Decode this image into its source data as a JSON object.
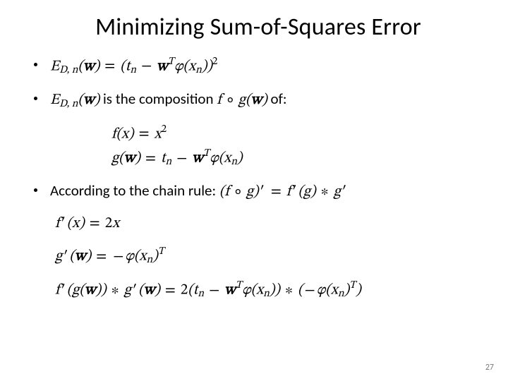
{
  "title": "Minimizing Sum-of-Squares Error",
  "bullet1_html": "E<sub>D, n</sub>(<b>w</b>) <span class='op'>=</span> (t<sub>n</sub> <span class='op'>−</span> <b>w</b><sup>T</sup>φ(x<sub>n</sub>))<sup><span class='upright'>2</span></sup>",
  "bullet2_prefix_html": "E<sub>D, n</sub>(<b>w</b>)",
  "bullet2_mid_text": " is the composition ",
  "bullet2_comp_html": "f <span class='op'>∘</span> g(<b>w</b>)",
  "bullet2_suffix_text": " of:",
  "block_f_html": "f(x) <span class='op'>=</span> x<sup><span class='upright'>2</span></sup>",
  "block_g_html": "g(<b>w</b>) <span class='op'>=</span> t<sub>n</sub> <span class='op'>−</span> <b>w</b><sup>T</sup>φ(x<sub>n</sub>)",
  "bullet3_text": "According to the chain rule: ",
  "bullet3_rule_html": "(f <span class='op'>∘</span> g)<span class='op'>′</span> <span class='op'>=</span> f<span class='op'>′</span>(g) <span class='op'>∗</span> g<span class='op'>′</span>",
  "deriv_fprime_html": "f<span class='op'>′</span>(x) <span class='op'>=</span> <span class='upright'>2</span>x",
  "deriv_gprime_html": "g<span class='op'>′</span>(<b>w</b>) <span class='op'>=</span> <span class='op'>−</span>φ(x<sub>n</sub>)<sup>T</sup>",
  "deriv_full_html": "f<span class='op'>′</span>(g(<b>w</b>)) <span class='op'>∗</span> g<span class='op'>′</span>(<b>w</b>) <span class='op'>=</span> <span class='upright'>2</span>(t<sub>n</sub> <span class='op'>−</span> <b>w</b><sup>T</sup>φ(x<sub>n</sub>)) <span class='op'>∗</span> (<span class='op'>−</span>φ(x<sub>n</sub>)<sup>T</sup>)",
  "slide_number": "27"
}
